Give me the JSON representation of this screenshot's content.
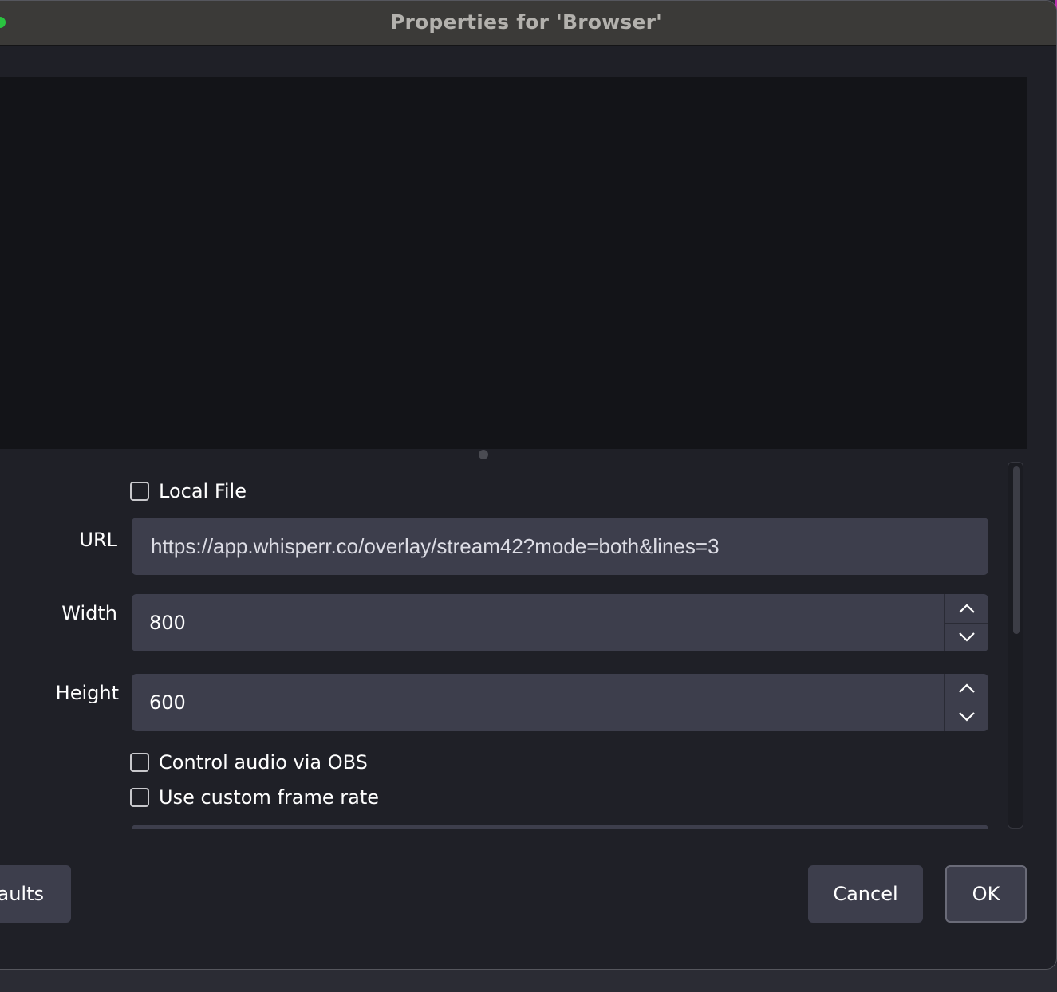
{
  "window": {
    "title": "Properties for 'Browser'"
  },
  "form": {
    "local_file": {
      "label": "Local File",
      "checked": false
    },
    "url": {
      "label": "URL",
      "value": "https://app.whisperr.co/overlay/stream42?mode=both&lines=3"
    },
    "width": {
      "label": "Width",
      "value": "800"
    },
    "height": {
      "label": "Height",
      "value": "600"
    },
    "control_audio": {
      "label": "Control audio via OBS",
      "checked": false
    },
    "custom_frame_rate": {
      "label": "Use custom frame rate",
      "checked": false
    }
  },
  "buttons": {
    "defaults_label": "aults",
    "cancel_label": "Cancel",
    "ok_label": "OK"
  },
  "colors": {
    "background": "#1f2027",
    "titlebar": "#3b3a38",
    "preview": "#131418",
    "field": "#3d3e4c",
    "traffic_green": "#2ac340"
  },
  "icons": {
    "stepper_up": "chevron-up-icon",
    "stepper_down": "chevron-down-icon"
  }
}
